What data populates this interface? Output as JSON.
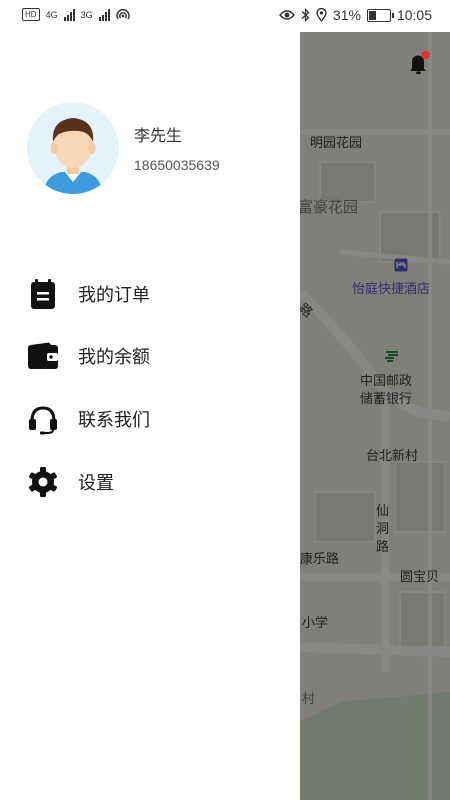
{
  "status_bar": {
    "left_badges": [
      "HD",
      "4G",
      "3G"
    ],
    "battery_percent": 31,
    "battery_text": "31%",
    "time": "10:05"
  },
  "user": {
    "name": "李先生",
    "phone": "18650035639"
  },
  "menu": [
    {
      "label": "我的订单",
      "icon": "clipboard-icon"
    },
    {
      "label": "我的余额",
      "icon": "wallet-icon"
    },
    {
      "label": "联系我们",
      "icon": "headset-icon"
    },
    {
      "label": "设置",
      "icon": "gear-icon"
    }
  ],
  "map": {
    "labels": [
      "明园花园",
      "富豪花园",
      "怡庭快捷酒店",
      "中国邮政",
      "储蓄银行",
      "台北新村",
      "仙",
      "洞",
      "路",
      "康乐路",
      "圆宝贝",
      "小学",
      "村",
      "路"
    ]
  },
  "colors": {
    "notification_dot": "#e0322c",
    "hotel_label": "#5c54c8",
    "post_office": "#1f8a3a"
  }
}
